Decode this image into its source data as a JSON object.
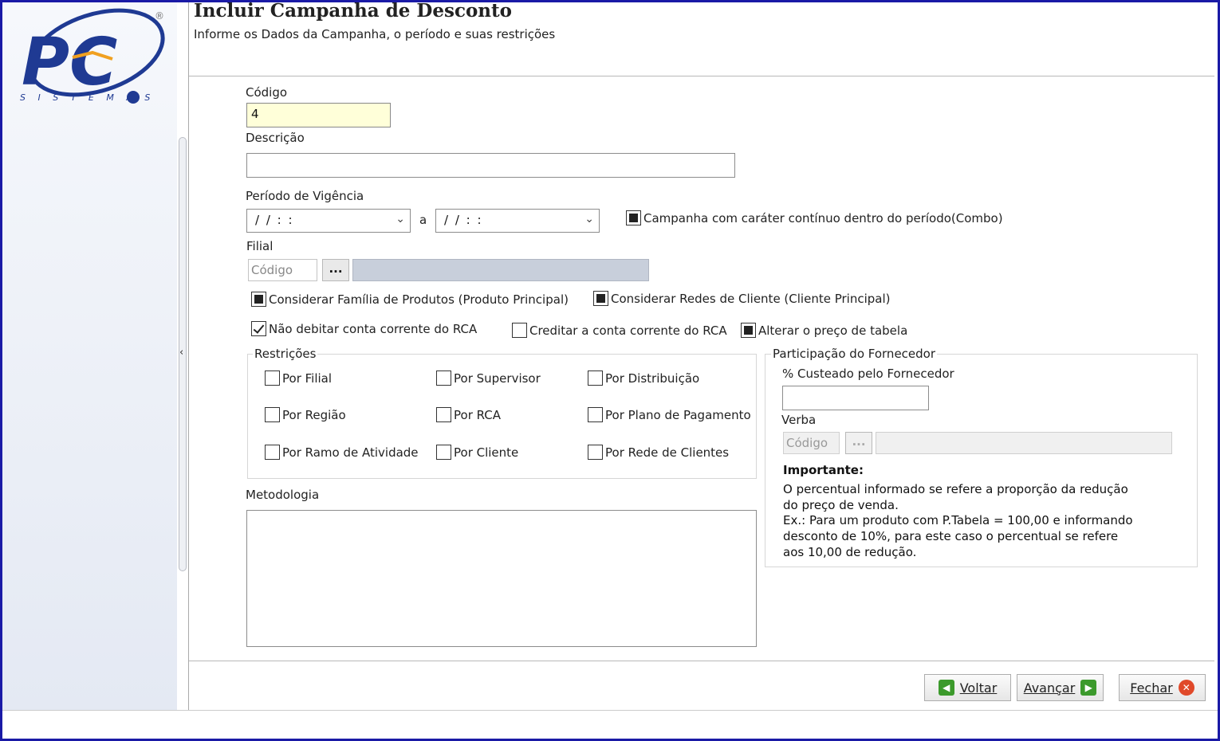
{
  "header": {
    "title": "Incluir Campanha de Desconto",
    "subtitle": "Informe os Dados da Campanha, o período e suas restrições"
  },
  "logo": {
    "text": "PC",
    "subtext": "S I S T E M A S",
    "registered": "®"
  },
  "form": {
    "codigo": {
      "label": "Código",
      "value": "4"
    },
    "descricao": {
      "label": "Descrição",
      "value": ""
    },
    "periodo": {
      "label": "Período de Vigência",
      "start": "/ /    : :",
      "separator": "a",
      "end": "/ /    : :"
    },
    "continuo": {
      "label": "Campanha com caráter contínuo dentro do período(Combo)",
      "checked": true
    },
    "filial": {
      "label": "Filial",
      "placeholder": "Código",
      "dots": "..."
    },
    "familia": {
      "label": "Considerar Família de Produtos (Produto Principal)",
      "checked": true
    },
    "redes": {
      "label": "Considerar Redes de Cliente (Cliente Principal)",
      "checked": true
    },
    "nao_debitar": {
      "label": "Não debitar conta corrente do RCA",
      "checked": true
    },
    "creditar": {
      "label": "Creditar a conta corrente do RCA",
      "checked": false
    },
    "alterar_preco": {
      "label": "Alterar o preço de tabela",
      "checked": true
    },
    "restricoes": {
      "title": "Restrições",
      "items": [
        "Por Filial",
        "Por Supervisor",
        "Por Distribuição",
        "Por Região",
        "Por RCA",
        "Por Plano de Pagamento",
        "Por Ramo de Atividade",
        "Por Cliente",
        "Por Rede de Clientes"
      ]
    },
    "metodologia": {
      "label": "Metodologia"
    },
    "fornecedor": {
      "title": "Participação do Fornecedor",
      "custeado_label": "% Custeado pelo Fornecedor",
      "verba_label": "Verba",
      "verba_placeholder": "Código",
      "dots": "...",
      "importante_title": "Importante:",
      "importante_lines": [
        "O percentual informado se refere a proporção da redução",
        "do preço de venda.",
        "Ex.: Para um produto com P.Tabela = 100,00 e informando",
        "desconto de 10%, para este caso o percentual se refere",
        "aos 10,00 de redução."
      ]
    }
  },
  "buttons": {
    "voltar": "Voltar",
    "avancar": "Avançar",
    "fechar": "Fechar"
  },
  "colors": {
    "frame": "#1a1aa6",
    "codigo_bg": "#ffffd9",
    "logo_blue": "#1f3a93",
    "logo_orange": "#f0a020"
  }
}
